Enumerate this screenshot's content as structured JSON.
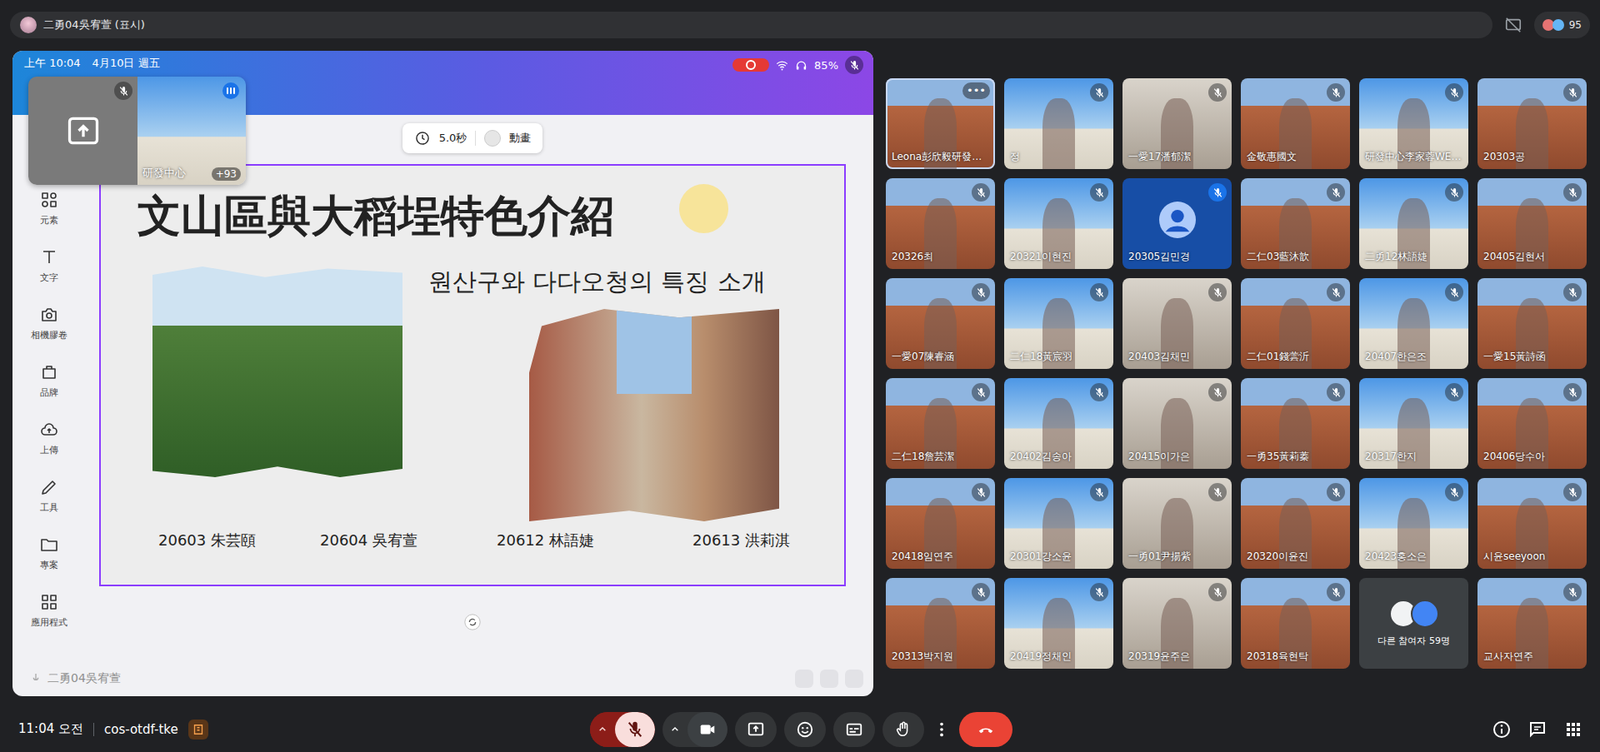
{
  "meeting_title": "二勇04吳宥萱 (표시)",
  "participant_count": "95",
  "shared_screen": {
    "status_bar": {
      "time": "上午 10:04",
      "date": "4月10日 週五",
      "battery": "85%",
      "recording": true
    },
    "presenter_muted": true,
    "pip": {
      "name": "研發中心",
      "extra": "+93",
      "muted": true
    },
    "toolbar": [
      {
        "label": "元素"
      },
      {
        "label": "文字"
      },
      {
        "label": "相機膠卷"
      },
      {
        "label": "品牌"
      },
      {
        "label": "上傳"
      },
      {
        "label": "工具"
      },
      {
        "label": "專案"
      },
      {
        "label": "應用程式"
      }
    ],
    "timer": {
      "duration": "5.0秒",
      "animate": "動畫"
    },
    "slide": {
      "title": "文山區與大稻埕特色介紹",
      "subtitle": "원산구와 다다오청의 특징 소개",
      "members": [
        "20603 朱芸頤",
        "20604 吳宥萱",
        "20612 林語婕",
        "20613 洪莉淇"
      ]
    },
    "presenter_label": "二勇04吳宥萱"
  },
  "tiles": [
    {
      "name": "Leona彭欣毅研發…",
      "kind": "video",
      "muted": false,
      "selected": true,
      "menu": "•••"
    },
    {
      "name": "정",
      "kind": "video",
      "muted": true,
      "selected": false
    },
    {
      "name": "一愛17潘郁潔",
      "kind": "video",
      "muted": true,
      "selected": false
    },
    {
      "name": "金敬惠國文",
      "kind": "video",
      "muted": true,
      "selected": false
    },
    {
      "name": "研發中心李家蓉WE…",
      "kind": "video",
      "muted": true,
      "selected": false
    },
    {
      "name": "20303공",
      "kind": "video",
      "muted": true,
      "selected": false
    },
    {
      "name": "20326최",
      "kind": "video",
      "muted": true,
      "selected": false
    },
    {
      "name": "20321이현진",
      "kind": "video",
      "muted": true,
      "selected": false
    },
    {
      "name": "20305김민경",
      "kind": "avatar",
      "muted": true,
      "selected": false
    },
    {
      "name": "二仁03藍沐歆",
      "kind": "video",
      "muted": true,
      "selected": false
    },
    {
      "name": "二勇12林語婕",
      "kind": "video",
      "muted": true,
      "selected": false
    },
    {
      "name": "20405김현서",
      "kind": "video",
      "muted": true,
      "selected": false
    },
    {
      "name": "一愛07陳睿涵",
      "kind": "video",
      "muted": true,
      "selected": false
    },
    {
      "name": "二仁18黃宸羽",
      "kind": "video",
      "muted": true,
      "selected": false
    },
    {
      "name": "20403김채민",
      "kind": "video",
      "muted": true,
      "selected": false
    },
    {
      "name": "二仁01錢蕓沂",
      "kind": "video",
      "muted": true,
      "selected": false
    },
    {
      "name": "20407한은조",
      "kind": "video",
      "muted": true,
      "selected": false
    },
    {
      "name": "一愛15黃詩函",
      "kind": "video",
      "muted": true,
      "selected": false
    },
    {
      "name": "二仁18詹芸潔",
      "kind": "video",
      "muted": true,
      "selected": false
    },
    {
      "name": "20402김송아",
      "kind": "video",
      "muted": true,
      "selected": false
    },
    {
      "name": "20415이가은",
      "kind": "video",
      "muted": true,
      "selected": false
    },
    {
      "name": "一勇35黃莉蓁",
      "kind": "video",
      "muted": true,
      "selected": false
    },
    {
      "name": "20317한지",
      "kind": "video",
      "muted": true,
      "selected": false
    },
    {
      "name": "20406당수아",
      "kind": "video",
      "muted": true,
      "selected": false
    },
    {
      "name": "20418임연주",
      "kind": "video",
      "muted": true,
      "selected": false
    },
    {
      "name": "20301강소윤",
      "kind": "video",
      "muted": true,
      "selected": false
    },
    {
      "name": "一勇01尹揚紫",
      "kind": "video",
      "muted": true,
      "selected": false
    },
    {
      "name": "20320이윤진",
      "kind": "video",
      "muted": true,
      "selected": false
    },
    {
      "name": "20423홍소은",
      "kind": "video",
      "muted": true,
      "selected": false
    },
    {
      "name": "시윤seeyoon",
      "kind": "video",
      "muted": true,
      "selected": false
    },
    {
      "name": "20313박지원",
      "kind": "video",
      "muted": true,
      "selected": false
    },
    {
      "name": "20419정채인",
      "kind": "video",
      "muted": true,
      "selected": false
    },
    {
      "name": "20319윤주은",
      "kind": "video",
      "muted": true,
      "selected": false
    },
    {
      "name": "20318육현탁",
      "kind": "video",
      "muted": true,
      "selected": false
    },
    {
      "name": "다른 참여자 59명",
      "kind": "others",
      "muted": false,
      "selected": false
    },
    {
      "name": "교사자연주",
      "kind": "video",
      "muted": true,
      "selected": false
    }
  ],
  "bottom_bar": {
    "time": "11:04 오전",
    "meeting_code": "cos-otdf-tke",
    "mic_on": false,
    "camera_on": true
  }
}
